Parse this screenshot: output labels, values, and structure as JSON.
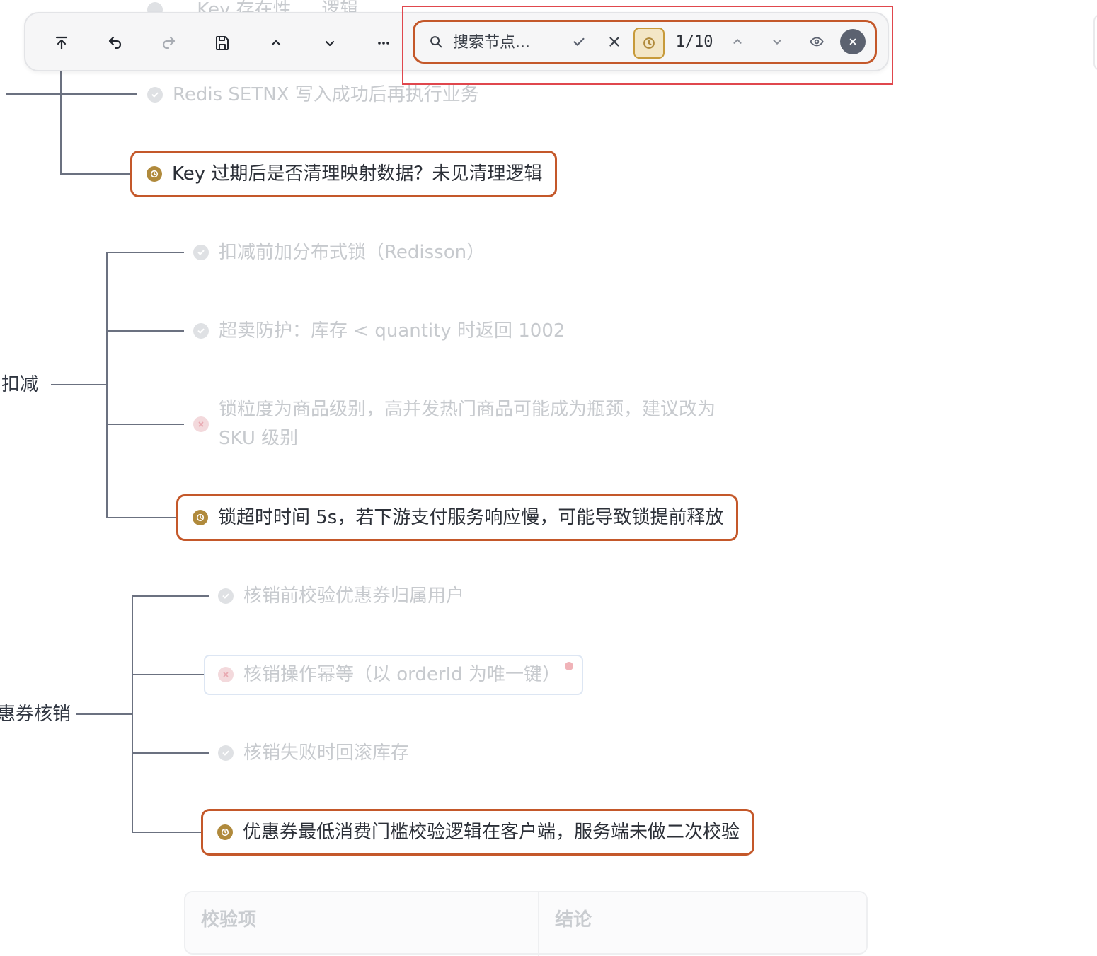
{
  "toolbar": {
    "buttons": [
      {
        "name": "scroll-to-top",
        "icon": "arrow-up-to-line-icon"
      },
      {
        "name": "undo",
        "icon": "undo-icon"
      },
      {
        "name": "redo",
        "icon": "redo-icon"
      },
      {
        "name": "save",
        "icon": "save-icon"
      },
      {
        "name": "collapse",
        "icon": "chevron-up-icon"
      },
      {
        "name": "expand",
        "icon": "chevron-down-icon"
      },
      {
        "name": "more",
        "icon": "more-horizontal-icon"
      }
    ]
  },
  "search": {
    "placeholder": "搜索节点...",
    "counter": "1/10",
    "icons": [
      "search-icon",
      "check-icon",
      "x-icon",
      "clock-icon",
      "chevron-up-icon",
      "chevron-down-icon",
      "eye-icon",
      "close-circle-icon"
    ]
  },
  "mindmap": {
    "top_cut_text": "… Key 存在性 … 逻辑",
    "group1": {
      "items": [
        {
          "text": "Redis SETNX 写入成功后再执行业务",
          "status": "ok"
        },
        {
          "text": "Key 过期后是否清理映射数据？未见清理逻辑",
          "status": "pending"
        }
      ]
    },
    "group2": {
      "label": "扣减",
      "items": [
        {
          "text": "扣减前加分布式锁（Redisson）",
          "status": "ok"
        },
        {
          "text": "超卖防护：库存 < quantity 时返回 1002",
          "status": "ok"
        },
        {
          "text": "锁粒度为商品级别，高并发热门商品可能成为瓶颈，建议改为",
          "text2": "SKU 级别",
          "status": "error"
        },
        {
          "text": "锁超时时间 5s，若下游支付服务响应慢，可能导致锁提前释放",
          "status": "pending"
        }
      ]
    },
    "group3": {
      "label": "惠券核销",
      "items": [
        {
          "text": "核销前校验优惠券归属用户",
          "status": "ok"
        },
        {
          "text": "核销操作幂等（以 orderId 为唯一键）",
          "status": "error"
        },
        {
          "text": "核销失败时回滚库存",
          "status": "ok"
        },
        {
          "text": "优惠券最低消费门槛校验逻辑在客户端，服务端未做二次校验",
          "status": "pending"
        }
      ]
    }
  },
  "table": {
    "headers": [
      "校验项",
      "结论"
    ]
  },
  "colors": {
    "highlight_border": "#c4582a",
    "pending_dot": "#b08a3c",
    "connector": "#6b7180",
    "faded_text": "#c7cace"
  }
}
